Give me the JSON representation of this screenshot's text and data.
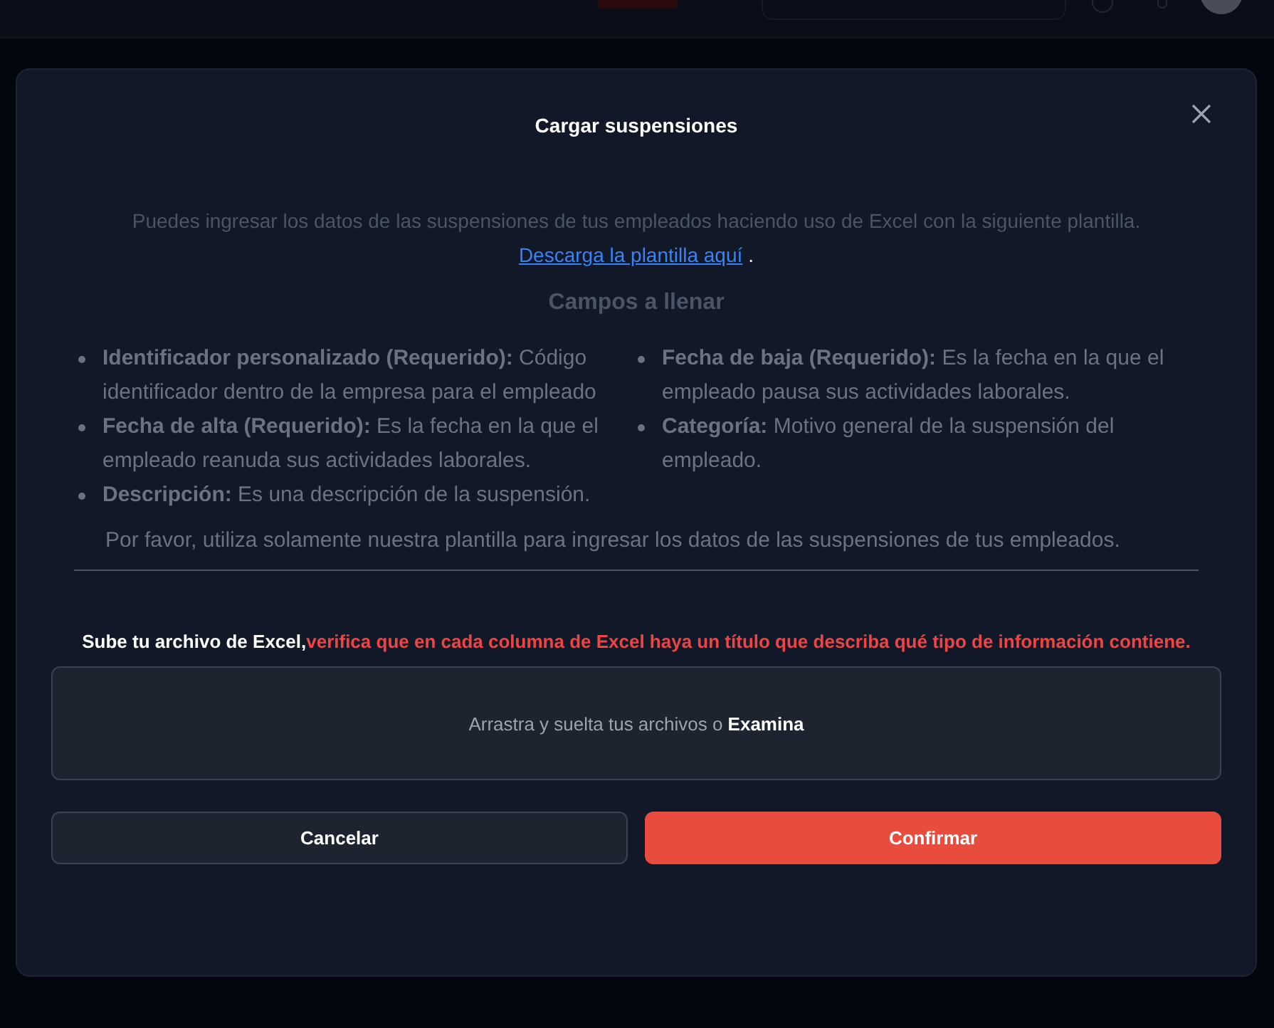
{
  "modal": {
    "title": "Cargar suspensiones",
    "intro": "Puedes ingresar los datos de las suspensiones de tus empleados haciendo uso de Excel con la siguiente plantilla.",
    "link": "Descarga la plantilla aquí",
    "link_after": ".",
    "fields_heading": "Campos a llenar",
    "fields_columns": [
      [
        {
          "text": "**Identificador personalizado (Requerido):** Código identificador dentro de la empresa para el empleado"
        },
        {
          "text": "**Fecha de alta (Requerido):** Es la fecha en la que el empleado reanuda sus actividades laborales."
        },
        {
          "text": "**Descripción:** Es una descripción de la suspensión."
        }
      ],
      [
        {
          "text": "**Fecha de baja (Requerido):** Es la fecha en la que el empleado pausa sus actividades laborales."
        },
        {
          "text": "**Categoría:** Motivo general de la suspensión del empleado."
        }
      ]
    ],
    "note": "Por favor, utiliza solamente nuestra plantilla para ingresar los datos de las suspensiones de tus empleados.",
    "upload_label": "Sube tu archivo de Excel,",
    "upload_warning": "verifica que en cada columna de Excel haya un título que describa qué tipo de información contiene.",
    "dropzone": "Arrastra y suelta tus archivos o **Examina**",
    "buttons": [
      {
        "label": "Cancelar",
        "kind": "secondary"
      },
      {
        "label": "Confirmar",
        "kind": "primary"
      }
    ]
  }
}
